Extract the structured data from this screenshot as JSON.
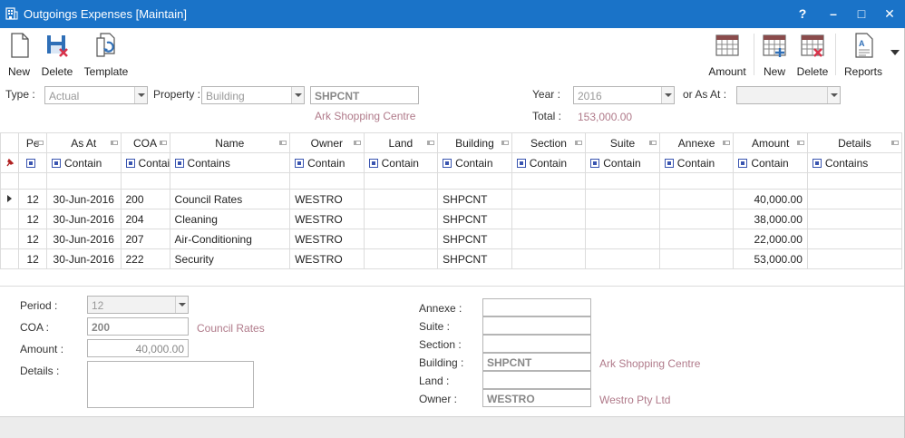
{
  "window": {
    "title": "Outgoings Expenses [Maintain]",
    "help": "?",
    "minimize": "–",
    "maximize": "□",
    "close": "✕"
  },
  "toolbar": {
    "left": [
      {
        "label": "New",
        "icon": "new-document-icon"
      },
      {
        "label": "Delete",
        "icon": "save-delete-icon"
      },
      {
        "label": "Template",
        "icon": "template-icon"
      }
    ],
    "right": [
      {
        "label": "Amount",
        "icon": "calendar-grid-icon"
      },
      {
        "label": "New",
        "icon": "calendar-add-icon"
      },
      {
        "label": "Delete",
        "icon": "calendar-delete-icon"
      },
      {
        "label": "Reports",
        "icon": "reports-icon"
      }
    ]
  },
  "filters": {
    "type_label": "Type :",
    "type_value": "Actual",
    "property_label": "Property :",
    "property_value": "Building",
    "property_code": "SHPCNT",
    "property_name": "Ark Shopping Centre",
    "year_label": "Year :",
    "year_value": "2016",
    "asat_label": "or As At :",
    "asat_value": "",
    "total_label": "Total :",
    "total_value": "153,000.00"
  },
  "grid": {
    "columns": [
      "Pe",
      "As At",
      "COA",
      "Name",
      "Owner",
      "Land",
      "Building",
      "Section",
      "Suite",
      "Annexe",
      "Amount",
      "Details"
    ],
    "filters": [
      "",
      "Contain",
      "Contai",
      "Contains",
      "Contain",
      "Contain",
      "Contain",
      "Contain",
      "Contain",
      "Contain",
      "Contain",
      "Contains"
    ],
    "rows": [
      {
        "period": "12",
        "as_at": "30-Jun-2016",
        "coa": "200",
        "name": "Council Rates",
        "owner": "WESTRO",
        "land": "",
        "building": "SHPCNT",
        "section": "",
        "suite": "",
        "annexe": "",
        "amount": "40,000.00",
        "details": ""
      },
      {
        "period": "12",
        "as_at": "30-Jun-2016",
        "coa": "204",
        "name": "Cleaning",
        "owner": "WESTRO",
        "land": "",
        "building": "SHPCNT",
        "section": "",
        "suite": "",
        "annexe": "",
        "amount": "38,000.00",
        "details": ""
      },
      {
        "period": "12",
        "as_at": "30-Jun-2016",
        "coa": "207",
        "name": "Air-Conditioning",
        "owner": "WESTRO",
        "land": "",
        "building": "SHPCNT",
        "section": "",
        "suite": "",
        "annexe": "",
        "amount": "22,000.00",
        "details": ""
      },
      {
        "period": "12",
        "as_at": "30-Jun-2016",
        "coa": "222",
        "name": "Security",
        "owner": "WESTRO",
        "land": "",
        "building": "SHPCNT",
        "section": "",
        "suite": "",
        "annexe": "",
        "amount": "53,000.00",
        "details": ""
      }
    ]
  },
  "detail": {
    "period_label": "Period :",
    "period_value": "12",
    "coa_label": "COA :",
    "coa_value": "200",
    "coa_name": "Council Rates",
    "amount_label": "Amount :",
    "amount_value": "40,000.00",
    "details_label": "Details :",
    "details_value": "",
    "annexe_label": "Annexe :",
    "annexe_value": "",
    "suite_label": "Suite :",
    "suite_value": "",
    "section_label": "Section :",
    "section_value": "",
    "building_label": "Building :",
    "building_value": "SHPCNT",
    "building_name": "Ark Shopping Centre",
    "land_label": "Land :",
    "land_value": "",
    "owner_label": "Owner :",
    "owner_value": "WESTRO",
    "owner_name": "Westro Pty Ltd"
  }
}
